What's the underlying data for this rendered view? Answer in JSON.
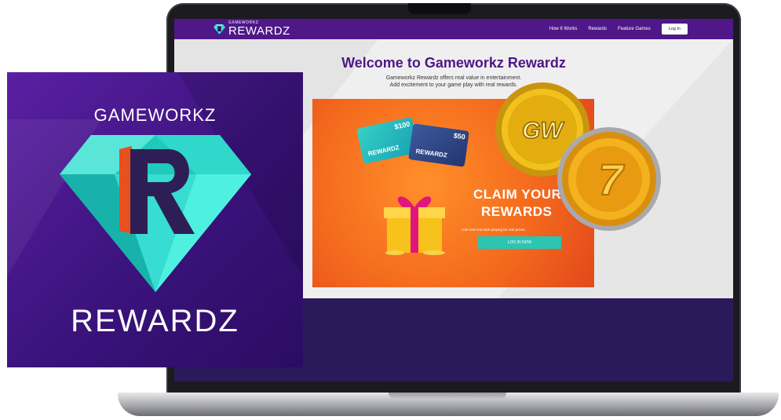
{
  "logo_tile": {
    "top_text": "GAMEWORKZ",
    "bottom_text": "REWARDZ"
  },
  "site": {
    "nav": {
      "brand_small": "GAMEWORKZ",
      "brand_big": "REWARDZ",
      "links": [
        "How It Works",
        "Rewards",
        "Feature Games"
      ],
      "login": "Log In"
    },
    "hero": {
      "title": "Welcome to Gameworkz Rewardz",
      "subtitle_1": "Gameworkz Rewardz offers real value in entertainment.",
      "subtitle_2": "Add excitement to your game play with real rewards."
    },
    "banner": {
      "card1_amount": "$100",
      "card1_name": "REWARDZ",
      "card2_amount": "$50",
      "card2_name": "REWARDZ",
      "claim_line1": "CLAIM YOUR",
      "claim_line2": "REWARDS",
      "sub": "Join now and start playing for real prizes.",
      "cta": "LOG IN NOW"
    },
    "coins": {
      "coin1": "GW",
      "coin2": "7"
    }
  },
  "colors": {
    "purple": "#4f1787",
    "teal": "#2cc5b1",
    "orange": "#f46a1d",
    "gold": "#e9b81a"
  }
}
